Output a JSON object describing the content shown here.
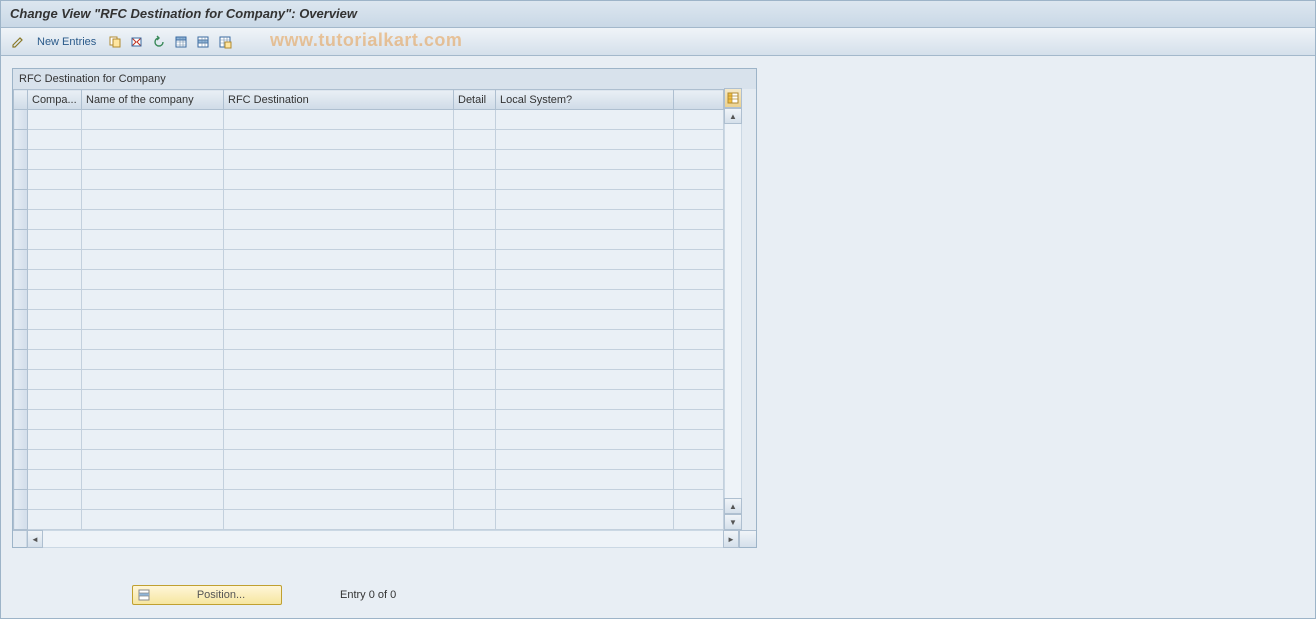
{
  "title": "Change View \"RFC Destination for Company\": Overview",
  "toolbar": {
    "new_entries": "New Entries"
  },
  "watermark": "www.tutorialkart.com",
  "table": {
    "caption": "RFC Destination for Company",
    "columns": {
      "compa": "Compa...",
      "name": "Name of the company",
      "rfc": "RFC Destination",
      "detail": "Detail",
      "local": "Local System?"
    },
    "row_count": 21
  },
  "footer": {
    "position_label": "Position...",
    "entry_status": "Entry 0 of 0"
  },
  "icons": {
    "pencil": "pencil",
    "copy": "copy",
    "save": "save",
    "undo": "undo",
    "select_all": "select-all",
    "table": "table",
    "print": "print",
    "settings": "table-settings"
  }
}
